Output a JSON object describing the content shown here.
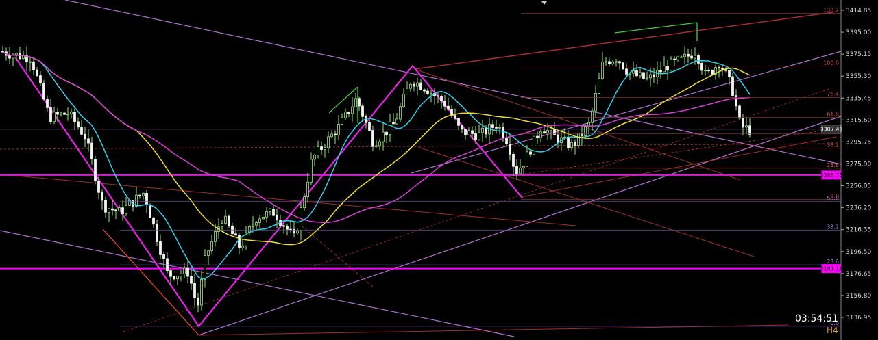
{
  "chart_data": {
    "type": "candlestick",
    "timeframe": "H4",
    "timer": "03:54:51",
    "current_price": "3307.41",
    "ylim": [
      3128,
      3420
    ],
    "y_ticks": [
      "3414.85",
      "3395.00",
      "3375.15",
      "3355.30",
      "3335.45",
      "3315.60",
      "3295.75",
      "3275.90",
      "3256.05",
      "3236.20",
      "3216.35",
      "3196.50",
      "3176.65",
      "3156.80",
      "3136.95"
    ],
    "price_tags": [
      {
        "label": "3307.41",
        "value": 3307.41,
        "color": "#cfcfcf"
      },
      {
        "label": "3265.75",
        "value": 3265.75,
        "color": "#ff00ff"
      },
      {
        "label": "3181.14",
        "value": 3181.14,
        "color": "#ff00ff"
      }
    ],
    "horizontal_lines": [
      {
        "value": 3265.75,
        "color": "#ff00ff",
        "width": 2
      },
      {
        "value": 3181.14,
        "color": "#ff00ff",
        "width": 2
      },
      {
        "value": 3307.41,
        "color": "#b8a0d0",
        "width": 1
      }
    ],
    "fib_upper": [
      {
        "label": "138.2",
        "value": 3412.0
      },
      {
        "label": "100.0",
        "value": 3364.5
      },
      {
        "label": "76.4",
        "value": 3336.0
      },
      {
        "label": "61.8",
        "value": 3318.0
      },
      {
        "label": "50.0",
        "value": 3303.0
      },
      {
        "label": "38.2",
        "value": 3290.0
      },
      {
        "label": "23.6",
        "value": 3272.0
      },
      {
        "label": "0.0",
        "value": 3243.8
      }
    ],
    "fib_lower": [
      {
        "label": "50.0",
        "value": 3242.0
      },
      {
        "label": "38.2",
        "value": 3216.0
      },
      {
        "label": "23.6",
        "value": 3184.5
      },
      {
        "label": "0.0",
        "value": 3129.0
      }
    ],
    "anchors": {
      "peak": 3364.5,
      "low": 3129.0,
      "trough": 3245.0,
      "high": 3391.0
    }
  }
}
